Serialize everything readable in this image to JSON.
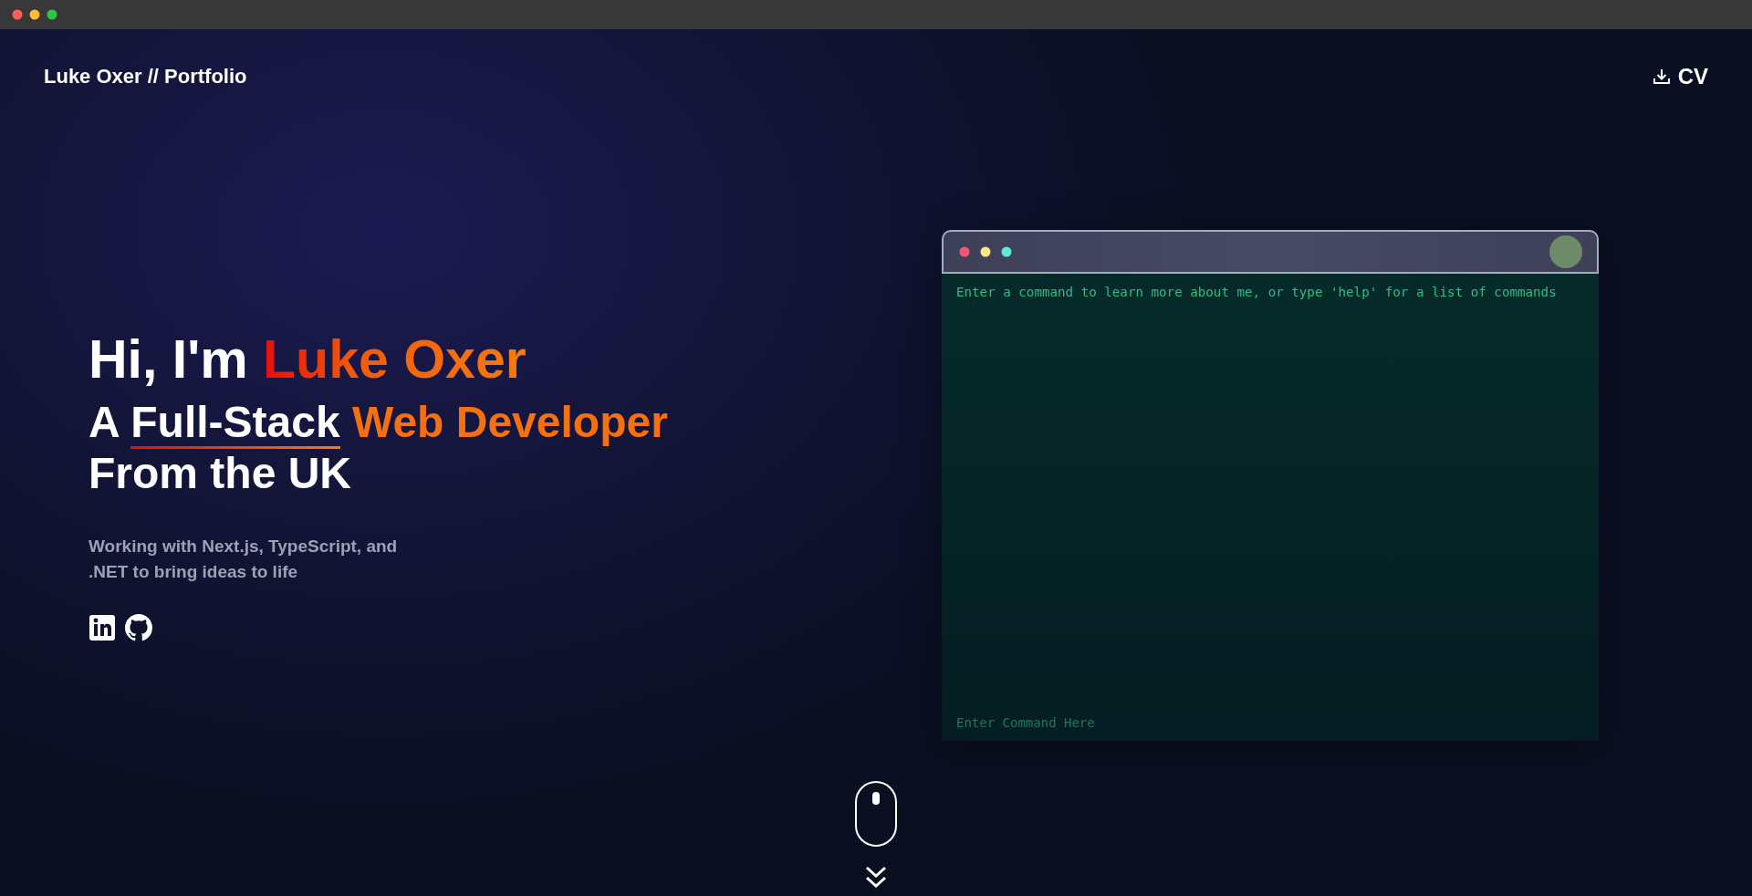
{
  "header": {
    "brand": "Luke Oxer // Portfolio",
    "cv_button": "CV"
  },
  "hero": {
    "greeting": "Hi, I'm",
    "name": "Luke Oxer",
    "line2_prefix": "A",
    "line2_highlight": "Full-Stack",
    "line2_accent": "Web Developer",
    "line3": "From the UK",
    "description": "Working with Next.js, TypeScript, and .NET to bring ideas to life",
    "social_links": [
      {
        "kind": "linkedin"
      },
      {
        "kind": "github"
      }
    ]
  },
  "terminal": {
    "intro": "Enter a command to learn more about me, or type 'help' for a list of commands",
    "input": {
      "placeholder": "Enter Command Here"
    }
  }
}
